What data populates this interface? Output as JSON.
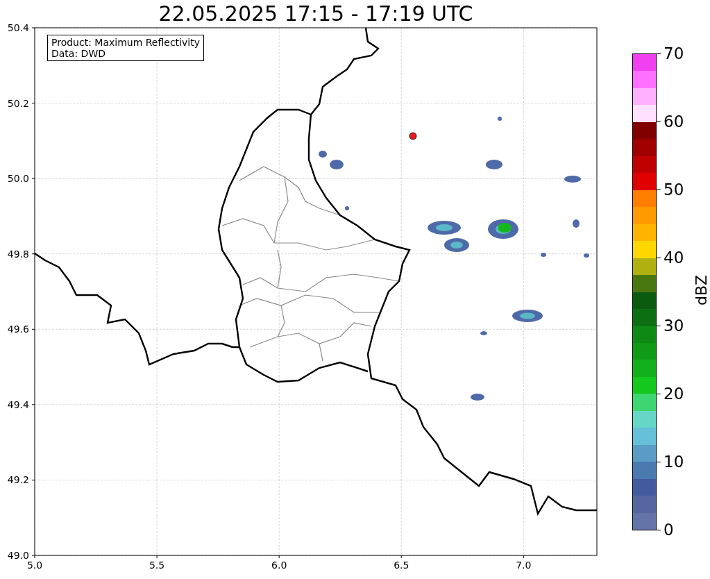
{
  "title": "22.05.2025 17:15 - 17:19 UTC",
  "map": {
    "info_box": [
      "Product: Maximum Reflectivity",
      "Data: DWD"
    ],
    "y_tick_labels": [
      "50.4",
      "50.2",
      "50.0",
      "49.8",
      "49.6",
      "49.4",
      "49.2",
      "49.0"
    ],
    "x_tick_labels": [
      "5.0",
      "5.5",
      "6.0",
      "6.5",
      "7.0"
    ]
  },
  "colorbar": {
    "label": "dBZ",
    "ticks": [
      "70",
      "60",
      "50",
      "40",
      "30",
      "20",
      "10",
      "0"
    ],
    "segments": [
      {
        "color": "#f040f0"
      },
      {
        "color": "#ff70ff"
      },
      {
        "color": "#ffb0ff"
      },
      {
        "color": "#ffe0ff"
      },
      {
        "color": "#800000"
      },
      {
        "color": "#a00000"
      },
      {
        "color": "#c00000"
      },
      {
        "color": "#e00000"
      },
      {
        "color": "#ff7e00"
      },
      {
        "color": "#ff9a00"
      },
      {
        "color": "#ffb400"
      },
      {
        "color": "#ffd700"
      },
      {
        "color": "#b0b010"
      },
      {
        "color": "#4a7810"
      },
      {
        "color": "#0a5a10"
      },
      {
        "color": "#0c7012"
      },
      {
        "color": "#0e8a14"
      },
      {
        "color": "#109a16"
      },
      {
        "color": "#12b01a"
      },
      {
        "color": "#14c81e"
      },
      {
        "color": "#3ed670"
      },
      {
        "color": "#66d6c6"
      },
      {
        "color": "#65c0d8"
      },
      {
        "color": "#5a9cc6"
      },
      {
        "color": "#4a7ab0"
      },
      {
        "color": "#435b9e"
      },
      {
        "color": "#5566a0"
      },
      {
        "color": "#6574a8"
      }
    ]
  }
}
